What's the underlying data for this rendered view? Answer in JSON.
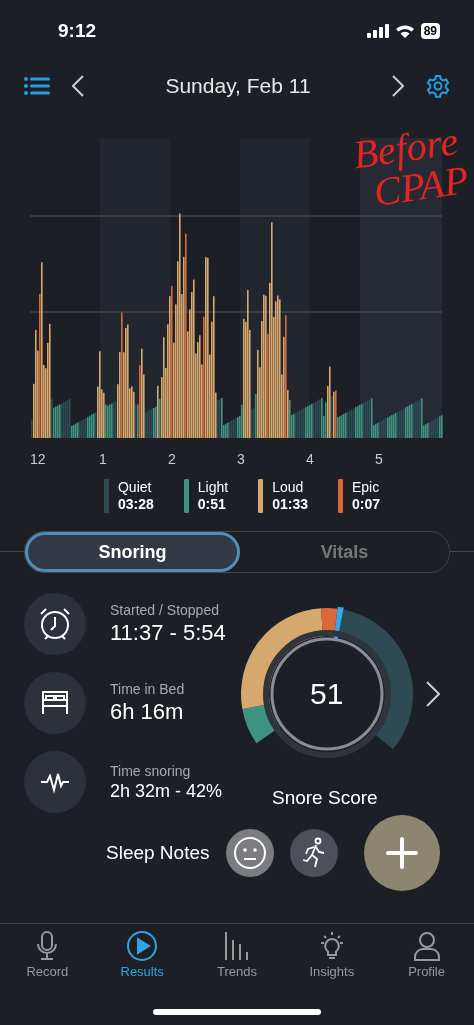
{
  "status_bar": {
    "time": "9:12",
    "battery": "89"
  },
  "header": {
    "date": "Sunday, Feb 11"
  },
  "annotation": {
    "line_1": "Before",
    "line_2": "CPAP"
  },
  "chart": {
    "hour_labels": [
      "12",
      "1",
      "2",
      "3",
      "4",
      "5"
    ]
  },
  "legend": [
    {
      "label": "Quiet",
      "time": "03:28",
      "color": "#2e4a55"
    },
    {
      "label": "Light",
      "time": "0:51",
      "color": "#3f9481"
    },
    {
      "label": "Loud",
      "time": "01:33",
      "color": "#d7a86e"
    },
    {
      "label": "Epic",
      "time": "0:07",
      "color": "#d9693b"
    }
  ],
  "tabs": [
    {
      "label": "Snoring",
      "selected": true
    },
    {
      "label": "Vitals",
      "selected": false
    }
  ],
  "stats": [
    {
      "kind": "alarm",
      "label": "Started / Stopped",
      "value": "11:37 - 5:54"
    },
    {
      "kind": "bed",
      "label": "Time in Bed",
      "value": "6h 16m"
    },
    {
      "kind": "pulse",
      "label": "Time snoring",
      "value": "2h 32m - 42%"
    }
  ],
  "score": {
    "value": "51",
    "label": "Snore Score"
  },
  "sleep_notes": {
    "label": "Sleep Notes",
    "notes": [
      {
        "kind": "face"
      },
      {
        "kind": "runner"
      }
    ]
  },
  "nav": [
    {
      "kind": "mic",
      "label": "Record",
      "selected": false
    },
    {
      "kind": "play",
      "label": "Results",
      "selected": true
    },
    {
      "kind": "bars",
      "label": "Trends",
      "selected": false
    },
    {
      "kind": "bulb",
      "label": "Insights",
      "selected": false
    },
    {
      "kind": "person",
      "label": "Profile",
      "selected": false
    }
  ]
}
